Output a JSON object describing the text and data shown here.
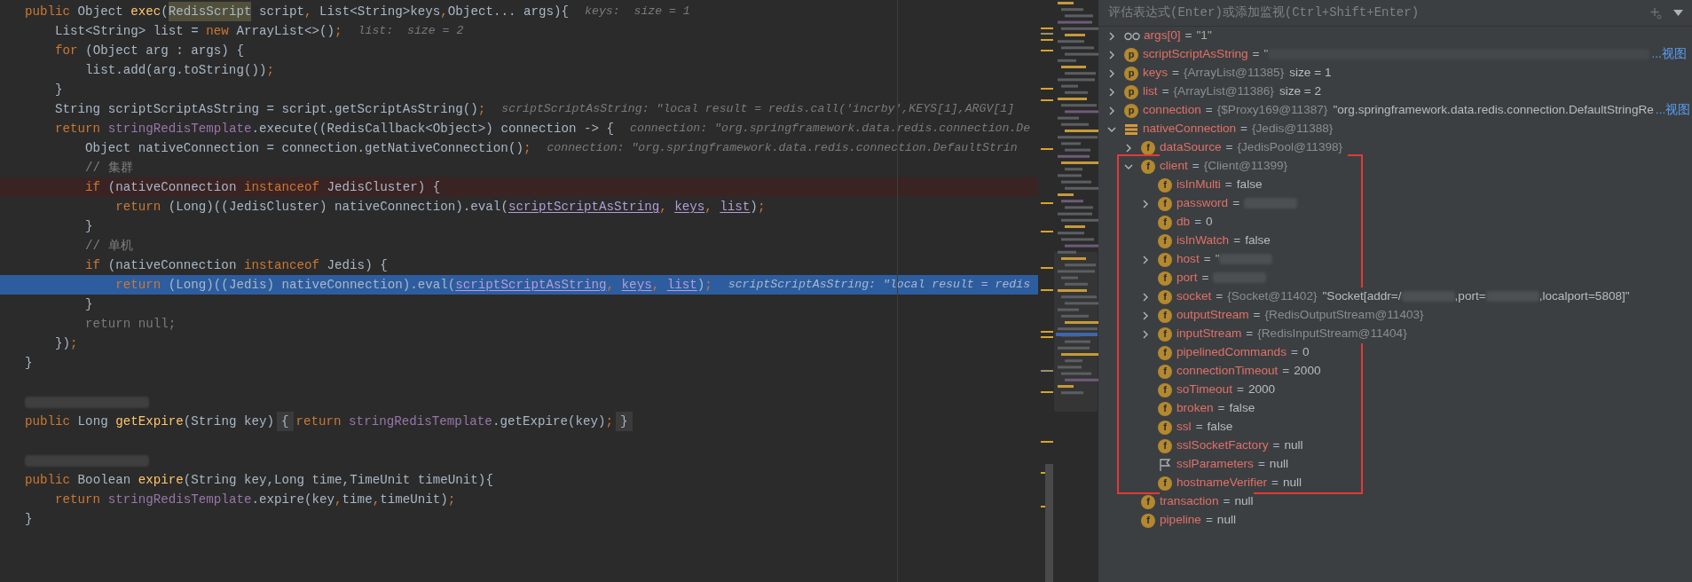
{
  "editor": {
    "lines": [
      {
        "kind": "normal",
        "tokens": [
          {
            "kind": "keyword",
            "text": "public "
          },
          {
            "kind": "plain",
            "text": "Object "
          },
          {
            "kind": "method",
            "text": "exec"
          },
          {
            "kind": "plain",
            "text": "("
          },
          {
            "kind": "match",
            "text": "RedisScript"
          },
          {
            "kind": "plain",
            "text": " script"
          },
          {
            "kind": "keyword",
            "text": ", "
          },
          {
            "kind": "plain",
            "text": "List<String>keys"
          },
          {
            "kind": "keyword",
            "text": ","
          },
          {
            "kind": "plain",
            "text": "Object... args){"
          }
        ],
        "hint": "keys:  size = 1"
      },
      {
        "kind": "normal",
        "tokens": [
          {
            "kind": "plain",
            "text": "    List<String> list = "
          },
          {
            "kind": "keyword",
            "text": "new "
          },
          {
            "kind": "plain",
            "text": "ArrayList<>()"
          },
          {
            "kind": "keyword",
            "text": ";"
          }
        ],
        "hint": "list:  size = 2"
      },
      {
        "kind": "normal",
        "tokens": [
          {
            "kind": "keyword",
            "text": "    for "
          },
          {
            "kind": "plain",
            "text": "(Object arg : args) {"
          }
        ]
      },
      {
        "kind": "normal",
        "tokens": [
          {
            "kind": "plain",
            "text": "        list.add(arg.toString())"
          },
          {
            "kind": "keyword",
            "text": ";"
          }
        ]
      },
      {
        "kind": "normal",
        "tokens": [
          {
            "kind": "plain",
            "text": "    }"
          }
        ]
      },
      {
        "kind": "normal",
        "tokens": [
          {
            "kind": "plain",
            "text": "    String scriptScriptAsString = script.getScriptAsString()"
          },
          {
            "kind": "keyword",
            "text": ";"
          }
        ],
        "hint": "scriptScriptAsString: \"local result = redis.call('incrby',KEYS[1],ARGV[1]"
      },
      {
        "kind": "normal",
        "tokens": [
          {
            "kind": "keyword",
            "text": "    return "
          },
          {
            "kind": "field",
            "text": "stringRedisTemplate"
          },
          {
            "kind": "plain",
            "text": ".execute((RedisCallback<Object>) connection -> {"
          }
        ],
        "hint": "connection: \"org.springframework.data.redis.connection.De"
      },
      {
        "kind": "normal",
        "tokens": [
          {
            "kind": "plain",
            "text": "        Object nativeConnection = connection.getNativeConnection()"
          },
          {
            "kind": "keyword",
            "text": ";"
          }
        ],
        "hint": "connection: \"org.springframework.data.redis.connection.DefaultStrin"
      },
      {
        "kind": "normal",
        "tokens": [
          {
            "kind": "comment",
            "text": "        // 集群"
          }
        ]
      },
      {
        "kind": "breakpoint",
        "tokens": [
          {
            "kind": "keyword",
            "text": "        if "
          },
          {
            "kind": "plain",
            "text": "(nativeConnection "
          },
          {
            "kind": "keyword",
            "text": "instanceof "
          },
          {
            "kind": "plain",
            "text": "JedisCluster) {"
          }
        ]
      },
      {
        "kind": "normal",
        "tokens": [
          {
            "kind": "keyword",
            "text": "            return "
          },
          {
            "kind": "plain",
            "text": "(Long)((JedisCluster) nativeConnection).eval("
          },
          {
            "kind": "captured",
            "text": "scriptScriptAsString"
          },
          {
            "kind": "keyword",
            "text": ", "
          },
          {
            "kind": "captured",
            "text": "keys"
          },
          {
            "kind": "keyword",
            "text": ", "
          },
          {
            "kind": "captured",
            "text": "list"
          },
          {
            "kind": "plain",
            "text": ")"
          },
          {
            "kind": "keyword",
            "text": ";"
          }
        ]
      },
      {
        "kind": "normal",
        "tokens": [
          {
            "kind": "plain",
            "text": "        }"
          }
        ]
      },
      {
        "kind": "normal",
        "tokens": [
          {
            "kind": "comment",
            "text": "        // 单机"
          }
        ]
      },
      {
        "kind": "normal",
        "tokens": [
          {
            "kind": "keyword",
            "text": "        if "
          },
          {
            "kind": "plain",
            "text": "(nativeConnection "
          },
          {
            "kind": "keyword",
            "text": "instanceof "
          },
          {
            "kind": "plain",
            "text": "Jedis) {"
          }
        ]
      },
      {
        "kind": "current",
        "tokens": [
          {
            "kind": "keyword",
            "text": "            return "
          },
          {
            "kind": "plain",
            "text": "(Long)((Jedis) nativeConnection).eval("
          },
          {
            "kind": "captured",
            "text": "scriptScriptAsString"
          },
          {
            "kind": "keyword",
            "text": ", "
          },
          {
            "kind": "captured",
            "text": "keys"
          },
          {
            "kind": "keyword",
            "text": ", "
          },
          {
            "kind": "captured",
            "text": "list"
          },
          {
            "kind": "plain",
            "text": ")"
          },
          {
            "kind": "keyword",
            "text": ";"
          }
        ],
        "hint": "scriptScriptAsString: \"local result = redis"
      },
      {
        "kind": "normal",
        "tokens": [
          {
            "kind": "plain",
            "text": "        }"
          }
        ]
      },
      {
        "kind": "normal",
        "tokens": [
          {
            "kind": "dimmed",
            "text": "        return null;"
          }
        ]
      },
      {
        "kind": "normal",
        "tokens": [
          {
            "kind": "plain",
            "text": "    })"
          },
          {
            "kind": "keyword",
            "text": ";"
          }
        ]
      },
      {
        "kind": "normal",
        "tokens": [
          {
            "kind": "plain",
            "text": "}"
          }
        ]
      },
      {
        "kind": "blank"
      },
      {
        "kind": "redacted"
      },
      {
        "kind": "normal",
        "tokens": [
          {
            "kind": "keyword",
            "text": "public "
          },
          {
            "kind": "plain",
            "text": "Long "
          },
          {
            "kind": "method",
            "text": "getExpire"
          },
          {
            "kind": "plain",
            "text": "(String key)"
          },
          {
            "kind": "folded",
            "text": "{"
          },
          {
            "kind": "keyword",
            "text": "return "
          },
          {
            "kind": "field",
            "text": "stringRedisTemplate"
          },
          {
            "kind": "plain",
            "text": ".getExpire(key)"
          },
          {
            "kind": "keyword",
            "text": ";"
          },
          {
            "kind": "folded",
            "text": "}"
          }
        ]
      },
      {
        "kind": "blank"
      },
      {
        "kind": "redacted"
      },
      {
        "kind": "normal",
        "tokens": [
          {
            "kind": "keyword",
            "text": "public "
          },
          {
            "kind": "plain",
            "text": "Boolean "
          },
          {
            "kind": "method",
            "text": "expire"
          },
          {
            "kind": "plain",
            "text": "(String key,Long time,TimeUnit timeUnit){"
          }
        ]
      },
      {
        "kind": "normal",
        "tokens": [
          {
            "kind": "keyword",
            "text": "    return "
          },
          {
            "kind": "field",
            "text": "stringRedisTemplate"
          },
          {
            "kind": "plain",
            "text": ".expire(key"
          },
          {
            "kind": "keyword",
            "text": ","
          },
          {
            "kind": "plain",
            "text": "time"
          },
          {
            "kind": "keyword",
            "text": ","
          },
          {
            "kind": "plain",
            "text": "timeUnit)"
          },
          {
            "kind": "keyword",
            "text": ";"
          }
        ]
      },
      {
        "kind": "normal",
        "tokens": [
          {
            "kind": "plain",
            "text": "}"
          }
        ]
      }
    ]
  },
  "debugger": {
    "watch_placeholder": "评估表达式(Enter)或添加监视(Ctrl+Shift+Enter)",
    "variables": [
      {
        "kind": "watch",
        "name": "args[0]",
        "expandable": true,
        "expanded": false,
        "value": [
          {
            "kind": "operator",
            "text": "="
          },
          {
            "kind": "string",
            "text": "\"1\""
          }
        ]
      },
      {
        "kind": "parameter",
        "badge": "p",
        "name": "scriptScriptAsString",
        "expandable": true,
        "expanded": false,
        "value": [
          {
            "kind": "operator",
            "text": "="
          },
          {
            "kind": "string",
            "text": "\""
          },
          {
            "kind": "redacted_long"
          }
        ],
        "link": "...视图"
      },
      {
        "kind": "parameter",
        "badge": "p",
        "name": "keys",
        "expandable": true,
        "expanded": false,
        "value": [
          {
            "kind": "operator",
            "text": "="
          },
          {
            "kind": "ref",
            "text": "{ArrayList@11385}"
          },
          {
            "kind": "text",
            "text": "size = 1"
          }
        ]
      },
      {
        "kind": "parameter",
        "badge": "p",
        "name": "list",
        "expandable": true,
        "expanded": false,
        "value": [
          {
            "kind": "operator",
            "text": "="
          },
          {
            "kind": "ref",
            "text": "{ArrayList@11386}"
          },
          {
            "kind": "text",
            "text": "size = 2"
          }
        ]
      },
      {
        "kind": "parameter",
        "badge": "p",
        "name": "connection",
        "expandable": true,
        "expanded": false,
        "value": [
          {
            "kind": "operator",
            "text": "="
          },
          {
            "kind": "ref",
            "text": "{$Proxy169@11387}"
          },
          {
            "kind": "text",
            "text": "\"org.springframework.data.redis.connection.DefaultStringRe"
          }
        ],
        "link": "...视图"
      },
      {
        "kind": "object",
        "name": "nativeConnection",
        "expandable": true,
        "expanded": true,
        "value": [
          {
            "kind": "operator",
            "text": "="
          },
          {
            "kind": "ref",
            "text": "{Jedis@11388}"
          }
        ],
        "children": [
          {
            "kind": "field",
            "badge": "f",
            "name": "dataSource",
            "expandable": true,
            "expanded": false,
            "value": [
              {
                "kind": "operator",
                "text": "="
              },
              {
                "kind": "ref",
                "text": "{JedisPool@11398}"
              }
            ]
          },
          {
            "kind": "field",
            "badge": "f",
            "name": "client",
            "expandable": true,
            "expanded": true,
            "highlighted": true,
            "value": [
              {
                "kind": "operator",
                "text": "="
              },
              {
                "kind": "ref",
                "text": "{Client@11399}"
              }
            ],
            "children": [
              {
                "kind": "field",
                "badge": "f",
                "name": "isInMulti",
                "expandable": false,
                "value": [
                  {
                    "kind": "operator",
                    "text": "="
                  },
                  {
                    "kind": "text",
                    "text": "false"
                  }
                ]
              },
              {
                "kind": "field",
                "badge": "f",
                "name": "password",
                "expandable": true,
                "expanded": false,
                "value": [
                  {
                    "kind": "operator",
                    "text": "="
                  },
                  {
                    "kind": "redacted"
                  }
                ]
              },
              {
                "kind": "field",
                "badge": "f",
                "name": "db",
                "expandable": false,
                "value": [
                  {
                    "kind": "operator",
                    "text": "="
                  },
                  {
                    "kind": "text",
                    "text": "0"
                  }
                ]
              },
              {
                "kind": "field",
                "badge": "f",
                "name": "isInWatch",
                "expandable": false,
                "value": [
                  {
                    "kind": "operator",
                    "text": "="
                  },
                  {
                    "kind": "text",
                    "text": "false"
                  }
                ]
              },
              {
                "kind": "field",
                "badge": "f",
                "name": "host",
                "expandable": true,
                "expanded": false,
                "value": [
                  {
                    "kind": "operator",
                    "text": "="
                  },
                  {
                    "kind": "string",
                    "text": "\""
                  },
                  {
                    "kind": "redacted"
                  }
                ]
              },
              {
                "kind": "field",
                "badge": "f",
                "name": "port",
                "expandable": false,
                "value": [
                  {
                    "kind": "operator",
                    "text": "="
                  },
                  {
                    "kind": "redacted"
                  }
                ]
              },
              {
                "kind": "field",
                "badge": "f",
                "name": "socket",
                "expandable": true,
                "expanded": false,
                "value": [
                  {
                    "kind": "operator",
                    "text": "="
                  },
                  {
                    "kind": "ref",
                    "text": "{Socket@11402}"
                  },
                  {
                    "kind": "text",
                    "text": "\"Socket[addr=/"
                  },
                  {
                    "kind": "redacted"
                  },
                  {
                    "kind": "text",
                    "text": ",port="
                  },
                  {
                    "kind": "redacted"
                  },
                  {
                    "kind": "text",
                    "text": ",localport=5808]\""
                  }
                ]
              },
              {
                "kind": "field",
                "badge": "f",
                "name": "outputStream",
                "expandable": true,
                "expanded": false,
                "value": [
                  {
                    "kind": "operator",
                    "text": "="
                  },
                  {
                    "kind": "ref",
                    "text": "{RedisOutputStream@11403}"
                  }
                ]
              },
              {
                "kind": "field",
                "badge": "f",
                "name": "inputStream",
                "expandable": true,
                "expanded": false,
                "value": [
                  {
                    "kind": "operator",
                    "text": "="
                  },
                  {
                    "kind": "ref",
                    "text": "{RedisInputStream@11404}"
                  }
                ]
              },
              {
                "kind": "field",
                "badge": "f",
                "name": "pipelinedCommands",
                "expandable": false,
                "value": [
                  {
                    "kind": "operator",
                    "text": "="
                  },
                  {
                    "kind": "text",
                    "text": "0"
                  }
                ]
              },
              {
                "kind": "field",
                "badge": "f",
                "name": "connectionTimeout",
                "expandable": false,
                "value": [
                  {
                    "kind": "operator",
                    "text": "="
                  },
                  {
                    "kind": "text",
                    "text": "2000"
                  }
                ]
              },
              {
                "kind": "field",
                "badge": "f",
                "name": "soTimeout",
                "expandable": false,
                "value": [
                  {
                    "kind": "operator",
                    "text": "="
                  },
                  {
                    "kind": "text",
                    "text": "2000"
                  }
                ]
              },
              {
                "kind": "field",
                "badge": "f",
                "name": "broken",
                "expandable": false,
                "value": [
                  {
                    "kind": "operator",
                    "text": "="
                  },
                  {
                    "kind": "text",
                    "text": "false"
                  }
                ]
              },
              {
                "kind": "field",
                "badge": "f",
                "name": "ssl",
                "expandable": false,
                "value": [
                  {
                    "kind": "operator",
                    "text": "="
                  },
                  {
                    "kind": "text",
                    "text": "false"
                  }
                ]
              },
              {
                "kind": "field",
                "badge": "f",
                "name": "sslSocketFactory",
                "expandable": false,
                "value": [
                  {
                    "kind": "operator",
                    "text": "="
                  },
                  {
                    "kind": "text",
                    "text": "null"
                  }
                ]
              },
              {
                "kind": "flag",
                "name": "sslParameters",
                "expandable": false,
                "value": [
                  {
                    "kind": "operator",
                    "text": "="
                  },
                  {
                    "kind": "text",
                    "text": "null"
                  }
                ]
              },
              {
                "kind": "field",
                "badge": "f",
                "name": "hostnameVerifier",
                "expandable": false,
                "value": [
                  {
                    "kind": "operator",
                    "text": "="
                  },
                  {
                    "kind": "text",
                    "text": "null"
                  }
                ]
              }
            ]
          },
          {
            "kind": "field",
            "badge": "f",
            "name": "transaction",
            "expandable": false,
            "value": [
              {
                "kind": "operator",
                "text": "="
              },
              {
                "kind": "text",
                "text": "null"
              }
            ]
          },
          {
            "kind": "field",
            "badge": "f",
            "name": "pipeline",
            "expandable": false,
            "value": [
              {
                "kind": "operator",
                "text": "="
              },
              {
                "kind": "text",
                "text": "null"
              }
            ]
          }
        ]
      }
    ]
  }
}
